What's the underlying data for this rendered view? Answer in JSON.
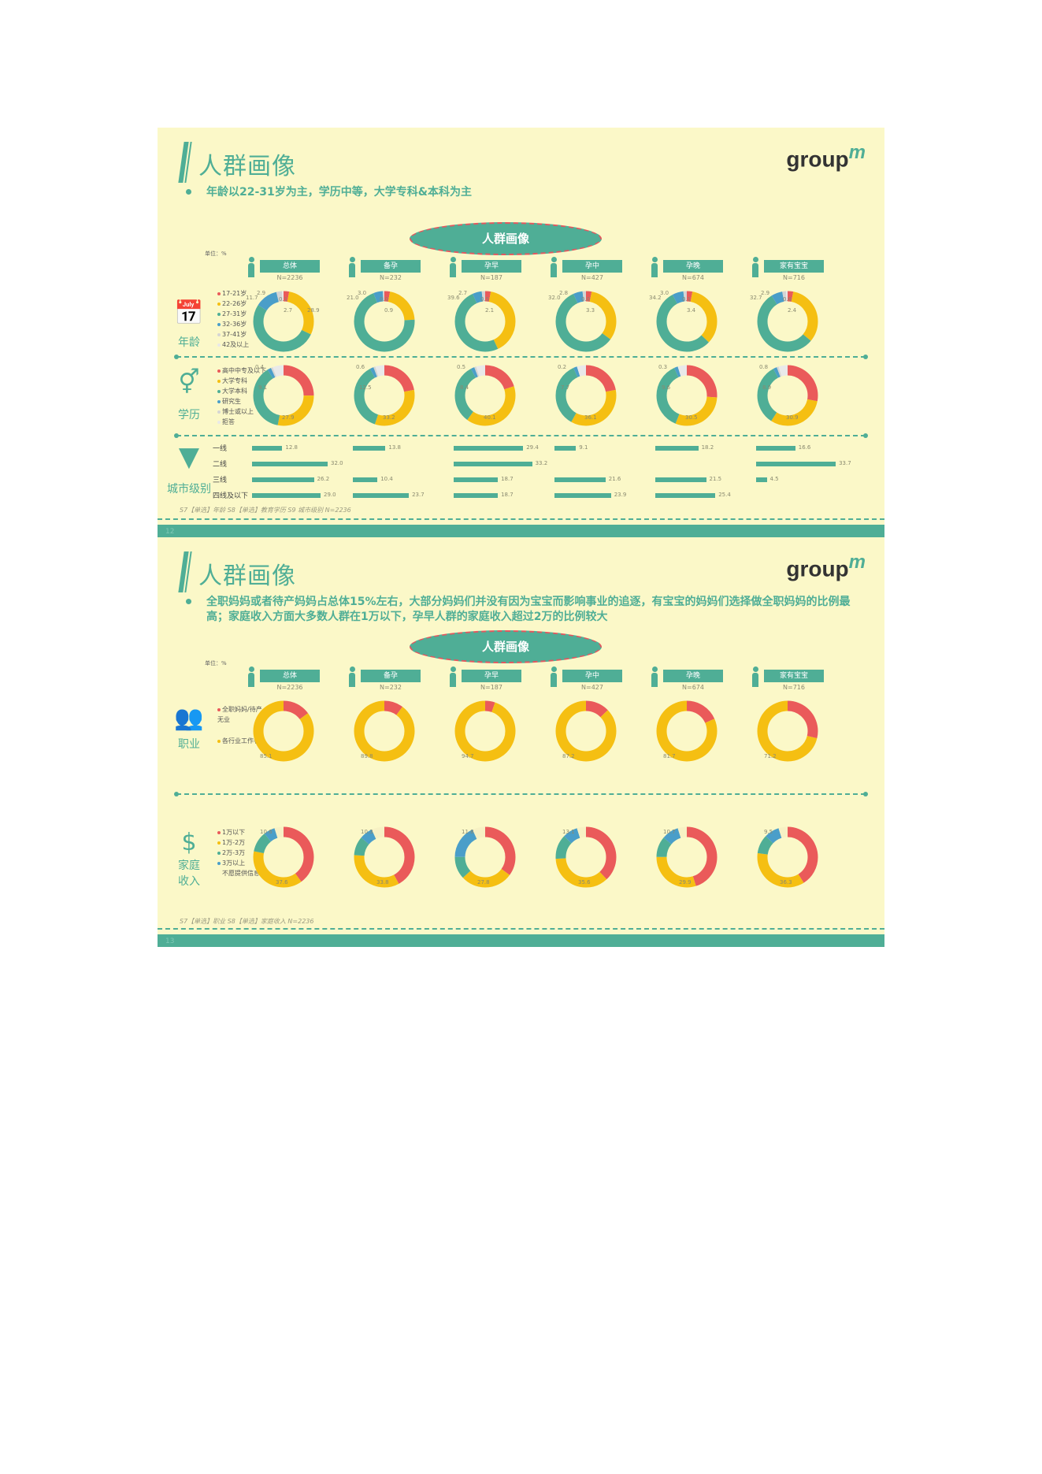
{
  "colors": {
    "teal": "#4fae96",
    "red": "#ea5a5a",
    "yellow": "#f5bf12",
    "blue": "#4a9ec9",
    "gray": "#d5d5d5",
    "cream": "#fbf8c8"
  },
  "slide1": {
    "title": "人群画像",
    "logo": "groupm",
    "subtitle": "年龄以22-31岁为主，学历中等，大学专科&本科为主",
    "banner": "人群画像",
    "unit": "单位：%",
    "segments": [
      {
        "name": "总体",
        "n": "N=2236"
      },
      {
        "name": "备孕",
        "n": "N=232"
      },
      {
        "name": "孕早",
        "n": "N=187"
      },
      {
        "name": "孕中",
        "n": "N=427"
      },
      {
        "name": "孕晚",
        "n": "N=674"
      },
      {
        "name": "家有宝宝",
        "n": "N=716"
      }
    ],
    "age": {
      "label": "年龄",
      "legend": [
        "17-21岁",
        "22-26岁",
        "27-31岁",
        "32-36岁",
        "37-41岁",
        "42及以上"
      ]
    },
    "edu": {
      "label": "学历",
      "legend": [
        "高中中专及以下",
        "大学专科",
        "大学本科",
        "研究生",
        "博士或以上",
        "拒答"
      ]
    },
    "city": {
      "label": "城市级别",
      "tiers": [
        "一线",
        "二线",
        "三线",
        "四线及以下"
      ]
    },
    "note": "S7【单选】年龄  S8【单选】教育学历  S9 城市级别  N=2236",
    "page": "12"
  },
  "slide2": {
    "title": "人群画像",
    "logo": "groupm",
    "subtitle": "全职妈妈或者待产妈妈占总体15%左右，大部分妈妈们并没有因为宝宝而影响事业的追逐，有宝宝的妈妈们选择做全职妈妈的比例最高；家庭收入方面大多数人群在1万以下，孕早人群的家庭收入超过2万的比例较大",
    "banner": "人群画像",
    "unit": "单位：%",
    "segments": [
      {
        "name": "总体",
        "n": "N=2236"
      },
      {
        "name": "备孕",
        "n": "N=232"
      },
      {
        "name": "孕早",
        "n": "N=187"
      },
      {
        "name": "孕中",
        "n": "N=427"
      },
      {
        "name": "孕晚",
        "n": "N=674"
      },
      {
        "name": "家有宝宝",
        "n": "N=716"
      }
    ],
    "job": {
      "label": "职业",
      "legend": [
        "全职妈妈/待产无业",
        "各行业工作者"
      ]
    },
    "income": {
      "label1": "家庭",
      "label2": "收入",
      "legend": [
        "1万以下",
        "1万-2万",
        "2万-3万",
        "3万以上",
        "不愿提供信息"
      ]
    },
    "note": "S7【单选】职业  S8【单选】家庭收入  N=2236",
    "page": "13"
  },
  "chart_data": [
    {
      "type": "pie",
      "title": "年龄",
      "categories": [
        "总体",
        "备孕",
        "孕早",
        "孕中",
        "孕晚",
        "家有宝宝"
      ],
      "labels": [
        [
          "2.9",
          "0.1",
          "2.7",
          "11.7",
          "28.9"
        ],
        [
          "3.0",
          "0.0",
          "0.9",
          "21.0"
        ],
        [
          "2.7",
          "0.5",
          "2.1",
          "39.6"
        ],
        [
          "2.8",
          "0.0",
          "3.3",
          "32.0"
        ],
        [
          "3.0",
          "0.1",
          "3.4",
          "34.2"
        ],
        [
          "2.9",
          "0.6",
          "2.4",
          "32.7"
        ]
      ]
    },
    {
      "type": "pie",
      "title": "学历",
      "categories": [
        "总体",
        "备孕",
        "孕早",
        "孕中",
        "孕晚",
        "家有宝宝"
      ],
      "labels": [
        [
          "0.4",
          "9.1",
          "27.9"
        ],
        [
          "0.6",
          "12.5",
          "33.2"
        ],
        [
          "0.5",
          "8.4",
          "40.1"
        ],
        [
          "0.2",
          "7.7",
          "36.1"
        ],
        [
          "0.3",
          "9.6",
          "30.5"
        ],
        [
          "0.8",
          "8.9",
          "30.9"
        ]
      ]
    },
    {
      "type": "bar",
      "title": "城市级别",
      "categories": [
        "一线",
        "二线",
        "三线",
        "四线及以下"
      ],
      "series": [
        {
          "name": "总体",
          "values": [
            12.8,
            32.0,
            26.2,
            29.0
          ]
        },
        {
          "name": "备孕",
          "values": [
            13.8,
            null,
            10.4,
            23.7
          ]
        },
        {
          "name": "孕早",
          "values": [
            29.4,
            33.2,
            18.7,
            18.7
          ]
        },
        {
          "name": "孕中",
          "values": [
            9.1,
            null,
            21.6,
            23.9
          ]
        },
        {
          "name": "孕晚",
          "values": [
            18.2,
            null,
            21.5,
            25.4
          ]
        },
        {
          "name": "家有宝宝",
          "values": [
            16.6,
            33.7,
            4.5,
            null
          ]
        }
      ]
    },
    {
      "type": "pie",
      "title": "职业",
      "categories": [
        "总体",
        "备孕",
        "孕早",
        "孕中",
        "孕晚",
        "家有宝宝"
      ],
      "labels": [
        "85.1",
        "89.8",
        "94.7",
        "87.2",
        "81.7",
        "71.2"
      ]
    },
    {
      "type": "pie",
      "title": "家庭收入",
      "categories": [
        "总体",
        "备孕",
        "孕早",
        "孕中",
        "孕晚",
        "家有宝宝"
      ],
      "labels": [
        [
          "10.6",
          "37.6"
        ],
        [
          "10.3",
          "33.8"
        ],
        [
          "11.8",
          "27.8"
        ],
        [
          "13.1",
          "35.6"
        ],
        [
          "10.7",
          "29.9"
        ],
        [
          "9.5",
          "36.3"
        ]
      ]
    }
  ]
}
